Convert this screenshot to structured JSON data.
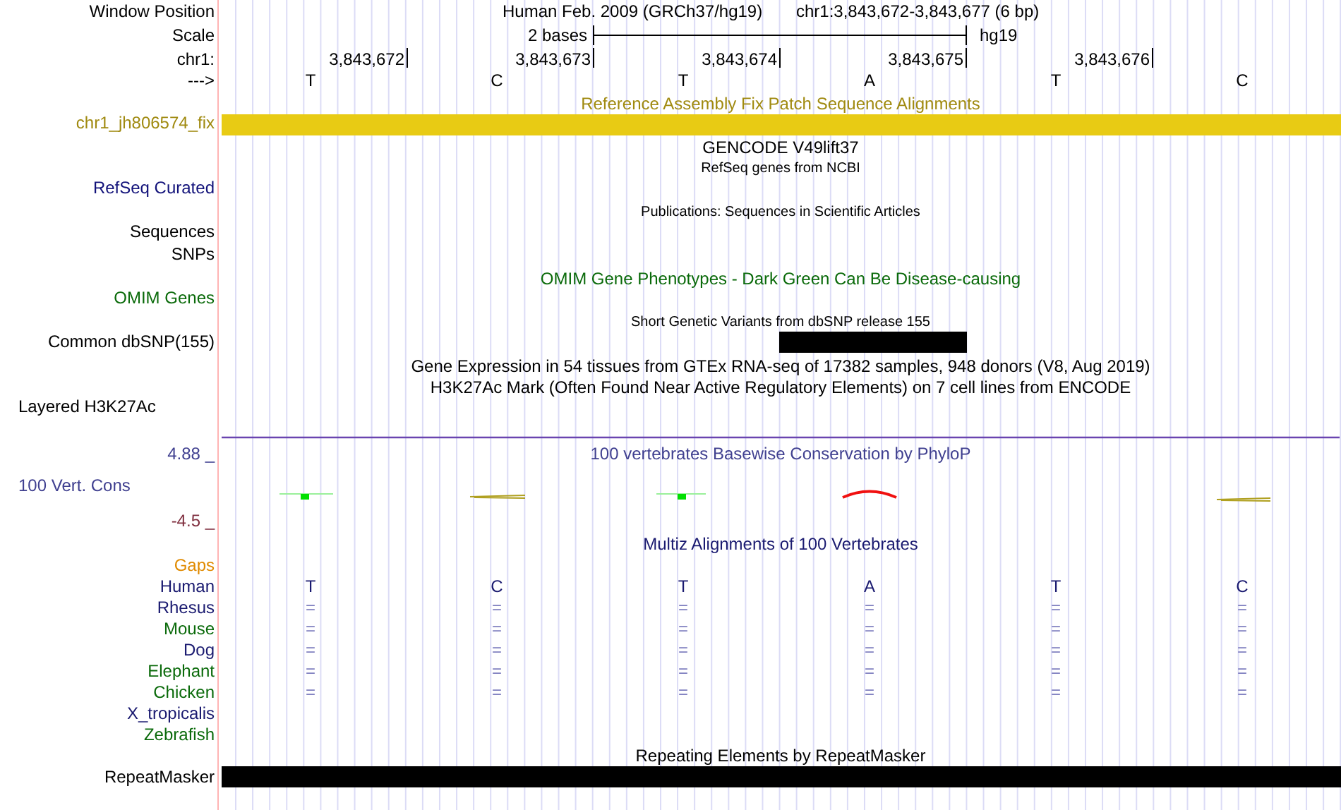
{
  "header": {
    "position_label": "Window Position",
    "assembly": "Human Feb. 2009 (GRCh37/hg19)",
    "position": "chr1:3,843,672-3,843,677 (6 bp)",
    "scale_label": "Scale",
    "scale_text": "2 bases",
    "scale_db": "hg19",
    "chrom_label": "chr1:",
    "ticks": [
      "3,843,672",
      "3,843,673",
      "3,843,674",
      "3,843,675",
      "3,843,676"
    ],
    "strand_label": "--->",
    "bases": [
      "T",
      "C",
      "T",
      "A",
      "T",
      "C"
    ]
  },
  "tracks": [
    {
      "kind": "patch",
      "title": "Reference Assembly Fix Patch Sequence Alignments",
      "color": "#a08a10",
      "rows": [
        {
          "label": "chr1_jh806574_fix"
        }
      ]
    },
    {
      "kind": "empty",
      "title": "GENCODE V49lift37",
      "color": "#000000"
    },
    {
      "kind": "empty",
      "caption": "RefSeq genes from NCBI",
      "color": "#12127a",
      "rows": [
        {
          "label": "RefSeq Curated"
        }
      ]
    },
    {
      "kind": "empty",
      "caption": "Publications: Sequences in Scientific Articles",
      "color": "#000000",
      "rows": [
        {
          "label": "Sequences"
        },
        {
          "label": "SNPs"
        }
      ]
    },
    {
      "kind": "empty",
      "title": "OMIM Gene Phenotypes - Dark Green Can Be Disease-causing",
      "color": "#0a6a0a",
      "rows": [
        {
          "label": "OMIM Genes"
        }
      ]
    },
    {
      "kind": "snp",
      "caption": "Short Genetic Variants from dbSNP release 155",
      "color": "#000000",
      "rows": [
        {
          "label": "Common dbSNP(155)",
          "variant_at_base": [
            false,
            false,
            false,
            true,
            false,
            false
          ]
        }
      ]
    },
    {
      "kind": "empty",
      "title": "Gene Expression in 54 tissues from GTEx RNA-seq of 17382 samples, 948 donors (V8, Aug 2019)",
      "color": "#000000"
    },
    {
      "kind": "layered",
      "title": "H3K27Ac Mark (Often Found Near Active Regulatory Elements) on 7 cell lines from ENCODE",
      "color": "#000000",
      "rows": [
        {
          "label": "Layered H3K27Ac"
        }
      ]
    },
    {
      "kind": "wiggle",
      "title": "100 vertebrates Basewise Conservation by PhyloP",
      "color": "#404090",
      "y_max": "4.88 _",
      "y_min": "-4.5 _",
      "rows": [
        {
          "label": "100 Vert. Cons"
        }
      ]
    },
    {
      "kind": "multiz",
      "title": "Multiz Alignments of 100 Vertebrates",
      "color": "#1a1a70",
      "rows": [
        {
          "label": "Gaps",
          "color": "#e08a00"
        },
        {
          "label": "Human",
          "color": "#1a1a70",
          "bases": [
            "T",
            "C",
            "T",
            "A",
            "T",
            "C"
          ]
        },
        {
          "label": "Rhesus",
          "color": "#1a1a70",
          "bases": [
            "=",
            "=",
            "=",
            "=",
            "=",
            "="
          ]
        },
        {
          "label": "Mouse",
          "color": "#0a6a0a",
          "bases": [
            "=",
            "=",
            "=",
            "=",
            "=",
            "="
          ]
        },
        {
          "label": "Dog",
          "color": "#1a1a70",
          "bases": [
            "=",
            "=",
            "=",
            "=",
            "=",
            "="
          ]
        },
        {
          "label": "Elephant",
          "color": "#0a6a0a",
          "bases": [
            "=",
            "=",
            "=",
            "=",
            "=",
            "="
          ]
        },
        {
          "label": "Chicken",
          "color": "#0a6a0a",
          "bases": [
            "=",
            "=",
            "=",
            "=",
            "=",
            "="
          ]
        },
        {
          "label": "X_tropicalis",
          "color": "#1a1a70"
        },
        {
          "label": "Zebrafish",
          "color": "#0a6a0a"
        }
      ]
    },
    {
      "kind": "repeat",
      "title": "Repeating Elements by RepeatMasker",
      "color": "#000000",
      "rows": [
        {
          "label": "RepeatMasker"
        }
      ]
    }
  ]
}
